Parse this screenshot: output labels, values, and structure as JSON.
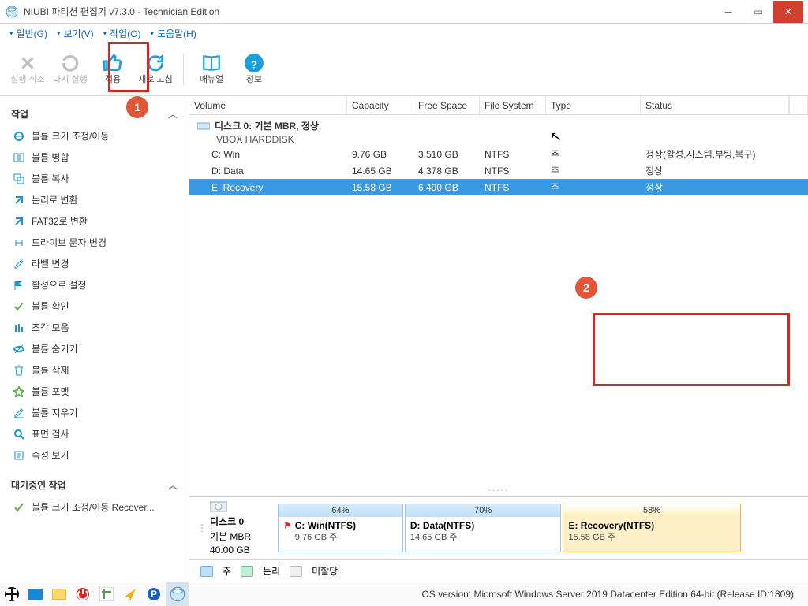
{
  "window": {
    "title": "NIUBI 파티션 편집기 v7.3.0 - Technician Edition"
  },
  "menu": {
    "general": "일반(G)",
    "view": "보기(V)",
    "actions": "작업(O)",
    "help": "도움말(H)"
  },
  "toolbar": {
    "undo": "실행 취소",
    "redo": "다시 실행",
    "apply": "적용",
    "refresh": "새로 고침",
    "manual": "매뉴얼",
    "info": "정보"
  },
  "badges": {
    "one": "1",
    "two": "2"
  },
  "sidebar": {
    "ops_header": "작업",
    "ops": [
      "볼륨 크기 조정/이동",
      "볼륨 병합",
      "볼륨 복사",
      "논리로 변환",
      "FAT32로 변환",
      "드라이브 문자 변경",
      "라벨 변경",
      "활성으로 설정",
      "볼륨 확인",
      "조각 모음",
      "볼륨 숨기기",
      "볼륨 삭제",
      "볼륨 포맷",
      "볼륨 지우기",
      "표면 검사",
      "속성 보기"
    ],
    "pending_header": "대기중인 작업",
    "pending": [
      "볼륨 크기 조정/이동 Recover..."
    ]
  },
  "columns": {
    "volume": "Volume",
    "capacity": "Capacity",
    "free": "Free Space",
    "fs": "File System",
    "type": "Type",
    "status": "Status"
  },
  "disk0": {
    "title": "디스크 0: 기본 MBR, 정상",
    "model": "VBOX HARDDISK"
  },
  "volumes": [
    {
      "name": "C: Win",
      "capacity": "9.76 GB",
      "free": "3.510 GB",
      "fs": "NTFS",
      "type": "주",
      "status": "정상(활성,시스템,부팅,복구)"
    },
    {
      "name": "D: Data",
      "capacity": "14.65 GB",
      "free": "4.378 GB",
      "fs": "NTFS",
      "type": "주",
      "status": "정상"
    },
    {
      "name": "E: Recovery",
      "capacity": "15.58 GB",
      "free": "6.490 GB",
      "fs": "NTFS",
      "type": "주",
      "status": "정상"
    }
  ],
  "map": {
    "disk_label": "디스크 0",
    "disk_type": "기본 MBR",
    "disk_size": "40.00 GB",
    "parts": [
      {
        "pct": "64%",
        "label": "C: Win(NTFS)",
        "sub": "9.76 GB 주",
        "flag": true
      },
      {
        "pct": "70%",
        "label": "D: Data(NTFS)",
        "sub": "14.65 GB 주",
        "flag": false
      },
      {
        "pct": "58%",
        "label": "E: Recovery(NTFS)",
        "sub": "15.58 GB 주",
        "flag": false
      }
    ]
  },
  "legend": {
    "primary": "주",
    "logical": "논리",
    "unalloc": "미할당"
  },
  "status": {
    "os": "OS version: Microsoft Windows Server 2019 Datacenter Edition  64-bit  (Release ID:1809)"
  }
}
